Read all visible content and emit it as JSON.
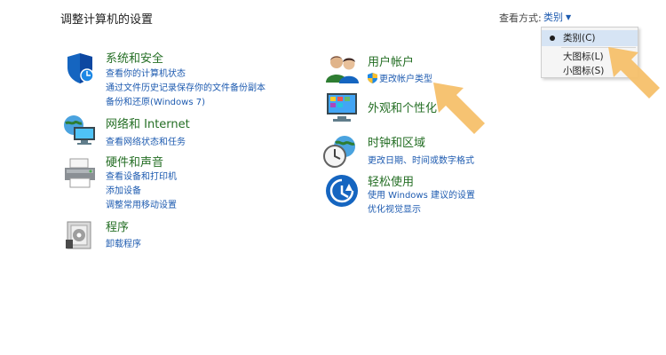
{
  "header": {
    "title": "调整计算机的设置",
    "view_by_label": "查看方式:",
    "view_by_value": "类别"
  },
  "view_menu": {
    "items": [
      {
        "label": "类别(C)",
        "selected": true
      },
      {
        "label": "大图标(L)",
        "selected": false
      },
      {
        "label": "小图标(S)",
        "selected": false
      }
    ]
  },
  "left_categories": [
    {
      "title": "系统和安全",
      "icon": "shield-icon",
      "links": [
        "查看你的计算机状态",
        "通过文件历史记录保存你的文件备份副本",
        "备份和还原(Windows 7)"
      ]
    },
    {
      "title": "网络和 Internet",
      "icon": "network-icon",
      "links": [
        "查看网络状态和任务"
      ]
    },
    {
      "title": "硬件和声音",
      "icon": "printer-icon",
      "links": [
        "查看设备和打印机",
        "添加设备",
        "调整常用移动设置"
      ]
    },
    {
      "title": "程序",
      "icon": "programs-icon",
      "links": [
        "卸载程序"
      ]
    }
  ],
  "right_categories": [
    {
      "title": "用户帐户",
      "icon": "users-icon",
      "links": [
        "更改帐户类型"
      ]
    },
    {
      "title": "外观和个性化",
      "icon": "appearance-icon",
      "links": []
    },
    {
      "title": "时钟和区域",
      "icon": "clock-globe-icon",
      "links": [
        "更改日期、时间或数字格式"
      ]
    },
    {
      "title": "轻松使用",
      "icon": "ease-of-access-icon",
      "links": [
        "使用 Windows 建议的设置",
        "优化视觉显示"
      ]
    }
  ],
  "colors": {
    "category_title": "#246e24",
    "link": "#1e5bb0",
    "annotation_arrow": "#f5c06a"
  }
}
